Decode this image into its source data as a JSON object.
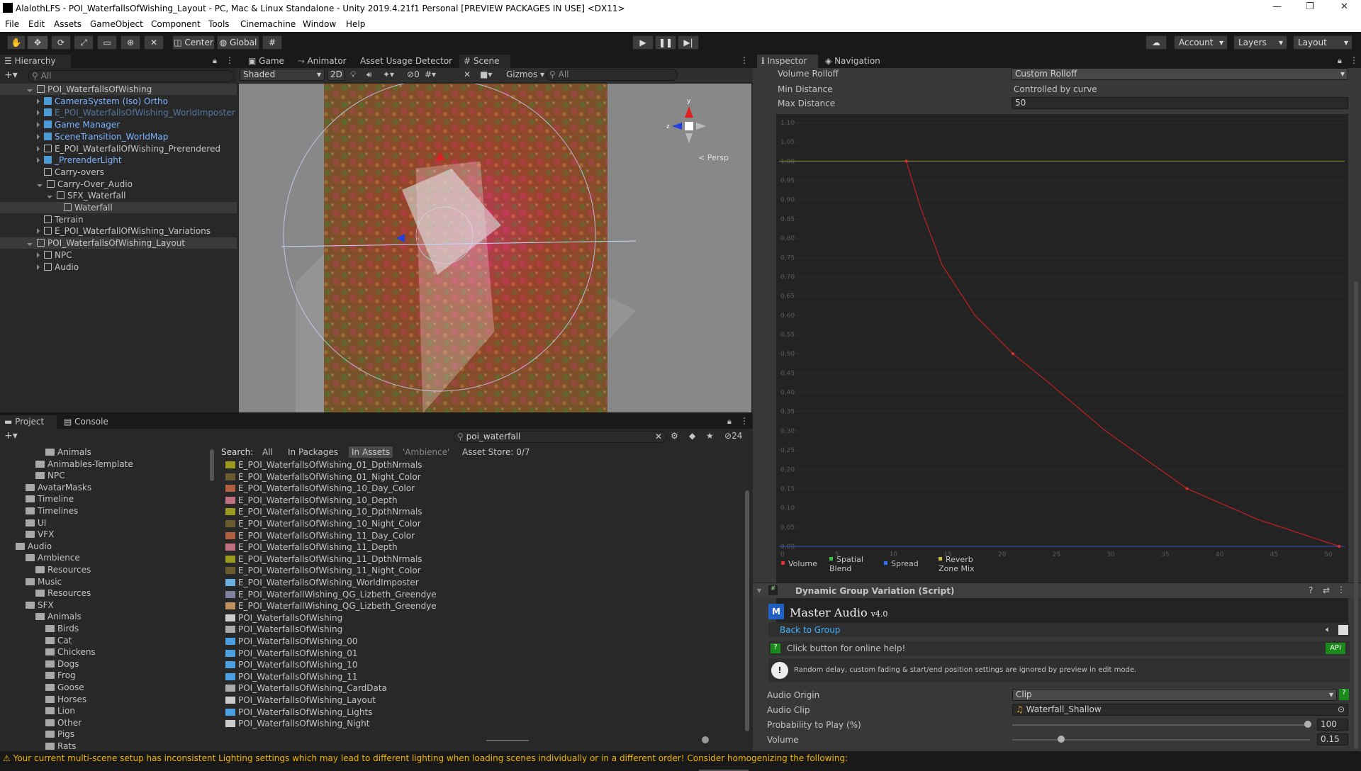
{
  "window": {
    "title": "AlalothLFS - POI_WaterfallsOfWishing_Layout - PC, Mac & Linux Standalone - Unity 2019.4.21f1 Personal [PREVIEW PACKAGES IN USE] <DX11>",
    "minimize": "—",
    "maximize": "❐",
    "close": "✕"
  },
  "menu": [
    "File",
    "Edit",
    "Assets",
    "GameObject",
    "Component",
    "Tools",
    "Cinemachine",
    "Window",
    "Help"
  ],
  "toolbar": {
    "pivot": "Center",
    "space": "Global",
    "account": "Account",
    "layers": "Layers",
    "layout": "Layout"
  },
  "hierarchy": {
    "tab": "Hierarchy",
    "search_placeholder": "All",
    "items": [
      {
        "label": "POI_WaterfallsOfWishing",
        "depth": 0,
        "type": "scene"
      },
      {
        "label": "CameraSystem (Iso) Ortho",
        "depth": 1,
        "type": "blue"
      },
      {
        "label": "E_POI_WaterfallsOfWishing_WorldImposter",
        "depth": 1,
        "type": "dimblue"
      },
      {
        "label": "Game Manager",
        "depth": 1,
        "type": "blue"
      },
      {
        "label": "SceneTransition_WorldMap",
        "depth": 1,
        "type": "blue"
      },
      {
        "label": "E_POI_WaterfallOfWishing_Prerendered",
        "depth": 1,
        "type": "obj"
      },
      {
        "label": "_PrerenderLight",
        "depth": 1,
        "type": "blue"
      },
      {
        "label": "Carry-overs",
        "depth": 1,
        "type": "obj"
      },
      {
        "label": "Carry-Over_Audio",
        "depth": 1,
        "type": "obj"
      },
      {
        "label": "SFX_Waterfall",
        "depth": 2,
        "type": "obj"
      },
      {
        "label": "Waterfall",
        "depth": 3,
        "type": "obj"
      },
      {
        "label": "Terrain",
        "depth": 1,
        "type": "obj"
      },
      {
        "label": "E_POI_WaterfallOfWishing_Variations",
        "depth": 1,
        "type": "obj"
      },
      {
        "label": "POI_WaterfallsOfWishing_Layout",
        "depth": 0,
        "type": "scene"
      },
      {
        "label": "NPC",
        "depth": 1,
        "type": "obj"
      },
      {
        "label": "Audio",
        "depth": 1,
        "type": "obj"
      }
    ]
  },
  "scene": {
    "tabs": [
      "Game",
      "Animator",
      "Asset Usage Detector",
      "Scene"
    ],
    "shading": "Shaded",
    "mode2d": "2D",
    "hidden_count": "0",
    "gizmos": "Gizmos",
    "search_placeholder": "All",
    "persp": "Persp",
    "axes": {
      "y": "y",
      "x": "x",
      "z": "z"
    }
  },
  "inspector": {
    "tabs": [
      "Inspector",
      "Navigation"
    ],
    "volume_rolloff_label": "Volume Rolloff",
    "volume_rolloff_value": "Custom Rolloff",
    "min_distance_label": "Min Distance",
    "min_distance_value": "Controlled by curve",
    "max_distance_label": "Max Distance",
    "max_distance_value": "50",
    "curve": {
      "y_ticks": [
        "1,10",
        "1,05",
        "1,00",
        "0,95",
        "0,90",
        "0,85",
        "0,80",
        "0,75",
        "0,70",
        "0,65",
        "0,60",
        "0,55",
        "0,50",
        "0,45",
        "0,40",
        "0,35",
        "0,30",
        "0,25",
        "0,20",
        "0,15",
        "0,10",
        "0,05",
        "0,00"
      ],
      "x_ticks": [
        "0",
        "5",
        "10",
        "15",
        "20",
        "25",
        "30",
        "35",
        "40",
        "45",
        "50"
      ],
      "legend": [
        "Volume",
        "Spatial Blend",
        "Spread",
        "Reverb Zone Mix"
      ],
      "legend_colors": [
        "#e03030",
        "#40c040",
        "#3070ff",
        "#d0c040"
      ]
    },
    "component_title": "Dynamic Group Variation (Script)",
    "brand": "Master Audio",
    "version": "v4.0",
    "back_to_group": "Back to Group",
    "help_text": "Click button for online help!",
    "api": "API",
    "warning_text": "Random delay, custom fading & start/end position settings are ignored by preview in edit mode.",
    "audio_origin_label": "Audio Origin",
    "audio_origin_value": "Clip",
    "audio_clip_label": "Audio Clip",
    "audio_clip_value": "Waterfall_Shallow",
    "probability_label": "Probability to Play (%)",
    "probability_value": "100",
    "volume_label": "Volume",
    "volume_value": "0.15"
  },
  "project": {
    "tabs": [
      "Project",
      "Console"
    ],
    "search_value": "poi_waterfall",
    "hidden_packages": "24",
    "search_label": "Search:",
    "scopes": [
      "All",
      "In Packages",
      "In Assets",
      "'Ambience'",
      "Asset Store: 0/7"
    ],
    "tree": [
      {
        "label": "Animals",
        "depth": 4
      },
      {
        "label": "Animables-Template",
        "depth": 3
      },
      {
        "label": "NPC",
        "depth": 3
      },
      {
        "label": "AvatarMasks",
        "depth": 2
      },
      {
        "label": "Timeline",
        "depth": 2
      },
      {
        "label": "Timelines",
        "depth": 2
      },
      {
        "label": "UI",
        "depth": 2
      },
      {
        "label": "VFX",
        "depth": 2
      },
      {
        "label": "Audio",
        "depth": 1
      },
      {
        "label": "Ambience",
        "depth": 2
      },
      {
        "label": "Resources",
        "depth": 3
      },
      {
        "label": "Music",
        "depth": 2
      },
      {
        "label": "Resources",
        "depth": 3
      },
      {
        "label": "SFX",
        "depth": 2
      },
      {
        "label": "Animals",
        "depth": 3
      },
      {
        "label": "Birds",
        "depth": 4
      },
      {
        "label": "Cat",
        "depth": 4
      },
      {
        "label": "Chickens",
        "depth": 4
      },
      {
        "label": "Dogs",
        "depth": 4
      },
      {
        "label": "Frog",
        "depth": 4
      },
      {
        "label": "Goose",
        "depth": 4
      },
      {
        "label": "Horses",
        "depth": 4
      },
      {
        "label": "Lion",
        "depth": 4
      },
      {
        "label": "Other",
        "depth": 4
      },
      {
        "label": "Pigs",
        "depth": 4
      },
      {
        "label": "Rats",
        "depth": 4
      }
    ],
    "results": [
      {
        "label": "E_POI_WaterfallsOfWishing_01_DpthNrmals",
        "thumb": "#9a9a20"
      },
      {
        "label": "E_POI_WaterfallsOfWishing_01_Night_Color",
        "thumb": "#6a5a30"
      },
      {
        "label": "E_POI_WaterfallsOfWishing_10_Day_Color",
        "thumb": "#b06040"
      },
      {
        "label": "E_POI_WaterfallsOfWishing_10_Depth",
        "thumb": "#c07080"
      },
      {
        "label": "E_POI_WaterfallsOfWishing_10_DpthNrmals",
        "thumb": "#9a9a20"
      },
      {
        "label": "E_POI_WaterfallsOfWishing_10_Night_Color",
        "thumb": "#6a5a30"
      },
      {
        "label": "E_POI_WaterfallsOfWishing_11_Day_Color",
        "thumb": "#b06040"
      },
      {
        "label": "E_POI_WaterfallsOfWishing_11_Depth",
        "thumb": "#c07080"
      },
      {
        "label": "E_POI_WaterfallsOfWishing_11_DpthNrmals",
        "thumb": "#9a9a20"
      },
      {
        "label": "E_POI_WaterfallsOfWishing_11_Night_Color",
        "thumb": "#6a5a30"
      },
      {
        "label": "E_POI_WaterfallsOfWishing_WorldImposter",
        "thumb": "#6ab0e0"
      },
      {
        "label": "E_POI_WaterfallWishing_QG_Lizbeth_Greendye",
        "thumb": "#8080a0"
      },
      {
        "label": "E_POI_WaterfallWishing_QG_Lizbeth_Greendye",
        "thumb": "#c09060"
      },
      {
        "label": "POI_WaterfallsOfWishing",
        "thumb": "#cccccc"
      },
      {
        "label": "POI_WaterfallsOfWishing",
        "thumb": "#aaaaaa"
      },
      {
        "label": "POI_WaterfallsOfWishing_00",
        "thumb": "#4aa0e0"
      },
      {
        "label": "POI_WaterfallsOfWishing_01",
        "thumb": "#4aa0e0"
      },
      {
        "label": "POI_WaterfallsOfWishing_10",
        "thumb": "#4aa0e0"
      },
      {
        "label": "POI_WaterfallsOfWishing_11",
        "thumb": "#4aa0e0"
      },
      {
        "label": "POI_WaterfallsOfWishing_CardData",
        "thumb": "#aaaaaa"
      },
      {
        "label": "POI_WaterfallsOfWishing_Layout",
        "thumb": "#cccccc"
      },
      {
        "label": "POI_WaterfallsOfWishing_Lights",
        "thumb": "#4aa0e0"
      },
      {
        "label": "POI_WaterfallsOfWishing_Night",
        "thumb": "#cccccc"
      }
    ]
  },
  "status": {
    "message": "Your current multi-scene setup has inconsistent Lighting settings which may lead to different lighting when loading scenes individually or in a different order! Consider homogenizing the following:"
  }
}
